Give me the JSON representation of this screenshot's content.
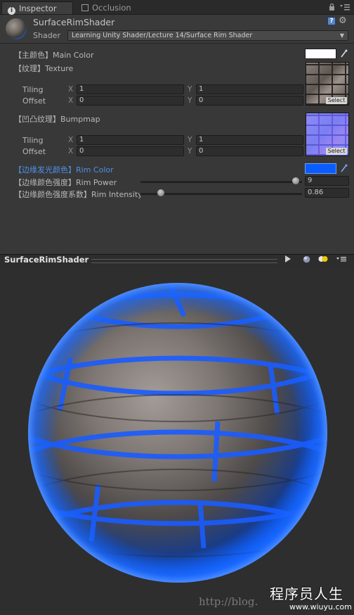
{
  "tabs": [
    {
      "label": "Inspector",
      "icon": "info-icon"
    },
    {
      "label": "Occlusion",
      "icon": "occlusion-icon"
    }
  ],
  "header": {
    "title": "SurfaceRimShader",
    "shader_label": "Shader",
    "shader_value": "Learning Unity Shader/Lecture 14/Surface Rim Shader"
  },
  "properties": {
    "main_color": {
      "label": "【主颜色】Main Color",
      "color": "#ffffff"
    },
    "texture": {
      "label": "【纹理】Texture",
      "tiling_label": "Tiling",
      "offset_label": "Offset",
      "x_label": "X",
      "y_label": "Y",
      "tiling_x": "1",
      "tiling_y": "1",
      "offset_x": "0",
      "offset_y": "0",
      "select_label": "Select"
    },
    "bumpmap": {
      "label": "【凹凸纹理】Bumpmap",
      "tiling_label": "Tiling",
      "offset_label": "Offset",
      "x_label": "X",
      "y_label": "Y",
      "tiling_x": "1",
      "tiling_y": "1",
      "offset_x": "0",
      "offset_y": "0",
      "select_label": "Select"
    },
    "rim_color": {
      "label": "【边缘发光颜色】Rim Color",
      "color": "#0a5cff"
    },
    "rim_power": {
      "label": "【边缘颜色强度】Rim Power",
      "value": "9",
      "fraction": 0.98
    },
    "rim_intensity": {
      "label": "【边缘颜色强度系数】Rim Intensity",
      "value": "0.86",
      "fraction": 0.11
    }
  },
  "preview": {
    "title": "SurfaceRimShader",
    "buttons": [
      "play-icon",
      "sphere-icon",
      "light-icon",
      "menu-icon"
    ]
  },
  "watermark": {
    "brand": "程序员人生",
    "url": "http://blog.",
    "site": "www.wiuyu.com"
  },
  "colors": {
    "rim": "#0a5cff",
    "label_highlight": "#4f8fe8",
    "panel_bg": "#383838"
  }
}
